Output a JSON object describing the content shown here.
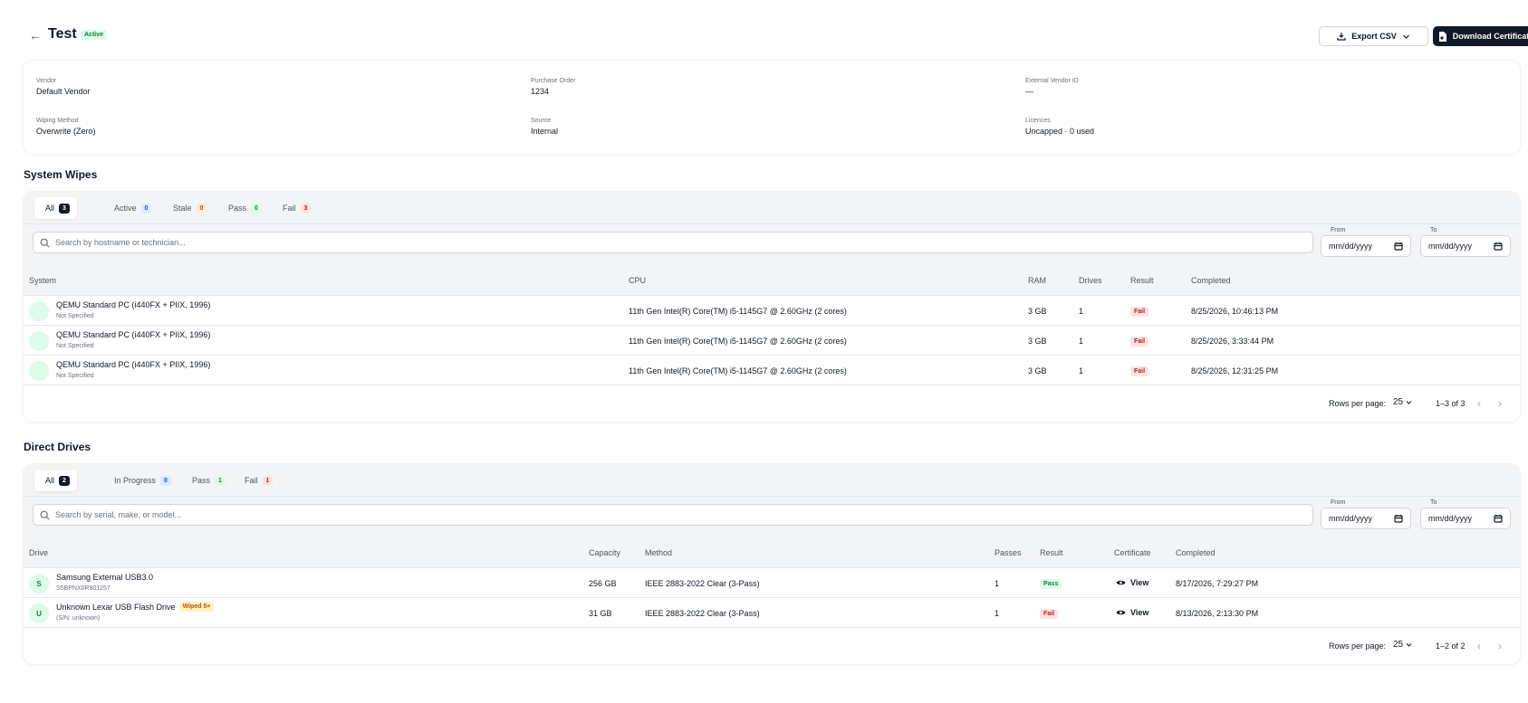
{
  "header": {
    "title": "Test",
    "status_badge": "Active",
    "export_label": "Export CSV",
    "download_label": "Download Certificates"
  },
  "info": {
    "vendor": {
      "label": "Vendor",
      "value": "Default Vendor"
    },
    "purchase_order": {
      "label": "Purchase Order",
      "value": "1234"
    },
    "external_vendor_id": {
      "label": "External Vendor ID",
      "value": "—"
    },
    "wiping_method": {
      "label": "Wiping Method",
      "value": "Overwrite (Zero)"
    },
    "source": {
      "label": "Source",
      "value": "Internal"
    },
    "licences": {
      "label": "Licences",
      "value": "Uncapped · 0 used"
    }
  },
  "system_wipes": {
    "title": "System Wipes",
    "tabs": [
      {
        "label": "All",
        "count": "3"
      },
      {
        "label": "Active",
        "count": "0"
      },
      {
        "label": "Stale",
        "count": "0"
      },
      {
        "label": "Pass",
        "count": "0"
      },
      {
        "label": "Fail",
        "count": "3"
      }
    ],
    "search_placeholder": "Search by hostname or technician...",
    "from_label": "From",
    "to_label": "To",
    "date_placeholder": "mm/dd/yyyy",
    "columns": [
      "System",
      "CPU",
      "RAM",
      "Drives",
      "Result",
      "Completed"
    ],
    "rows": [
      {
        "system": "QEMU Standard PC (i440FX + PIIX, 1996)",
        "sub": "Not Specified",
        "cpu": "11th Gen Intel(R) Core(TM) i5-1145G7 @ 2.60GHz (2 cores)",
        "ram": "3 GB",
        "drives": "1",
        "result": "Fail",
        "completed": "8/25/2026, 10:46:13 PM"
      },
      {
        "system": "QEMU Standard PC (i440FX + PIIX, 1996)",
        "sub": "Not Specified",
        "cpu": "11th Gen Intel(R) Core(TM) i5-1145G7 @ 2.60GHz (2 cores)",
        "ram": "3 GB",
        "drives": "1",
        "result": "Fail",
        "completed": "8/25/2026, 3:33:44 PM"
      },
      {
        "system": "QEMU Standard PC (i440FX + PIIX, 1996)",
        "sub": "Not Specified",
        "cpu": "11th Gen Intel(R) Core(TM) i5-1145G7 @ 2.60GHz (2 cores)",
        "ram": "3 GB",
        "drives": "1",
        "result": "Fail",
        "completed": "8/25/2026, 12:31:25 PM"
      }
    ],
    "rows_per_page_label": "Rows per page:",
    "rows_per_page": "25",
    "range": "1–3 of 3"
  },
  "direct_drives": {
    "title": "Direct Drives",
    "tabs": [
      {
        "label": "All",
        "count": "2"
      },
      {
        "label": "In Progress",
        "count": "0"
      },
      {
        "label": "Pass",
        "count": "1"
      },
      {
        "label": "Fail",
        "count": "1"
      }
    ],
    "search_placeholder": "Search by serial, make, or model...",
    "from_label": "From",
    "to_label": "To",
    "date_placeholder": "mm/dd/yyyy",
    "columns": [
      "Drive",
      "Capacity",
      "Method",
      "Passes",
      "Result",
      "Certificate",
      "Completed"
    ],
    "rows": [
      {
        "initial": "S",
        "drive": "Samsung External USB3.0",
        "tag": "",
        "sub": "S5BPNX0R801257",
        "capacity": "256 GB",
        "method": "IEEE 2883-2022 Clear (3-Pass)",
        "passes": "1",
        "result": "Pass",
        "certificate": "View",
        "completed": "8/17/2026, 7:29:27 PM"
      },
      {
        "initial": "U",
        "drive": "Unknown Lexar USB Flash Drive",
        "tag": "Wiped 5×",
        "sub": "(S/N: unknown)",
        "capacity": "31 GB",
        "method": "IEEE 2883-2022 Clear (3-Pass)",
        "passes": "1",
        "result": "Fail",
        "certificate": "View",
        "completed": "8/13/2026, 2:13:30 PM"
      }
    ],
    "rows_per_page_label": "Rows per page:",
    "rows_per_page": "25",
    "range": "1–2 of 2"
  },
  "colors": {
    "primary": "#111827",
    "pass": "#15803d",
    "fail": "#b91c1c",
    "info": "#1d4ed8",
    "warn": "#c2410c"
  },
  "icons": [
    "arrow-left-icon",
    "download-icon",
    "chevron-down-icon",
    "file-certificate-icon",
    "search-icon",
    "calendar-icon",
    "eye-icon",
    "chevron-left-icon",
    "chevron-right-icon"
  ]
}
